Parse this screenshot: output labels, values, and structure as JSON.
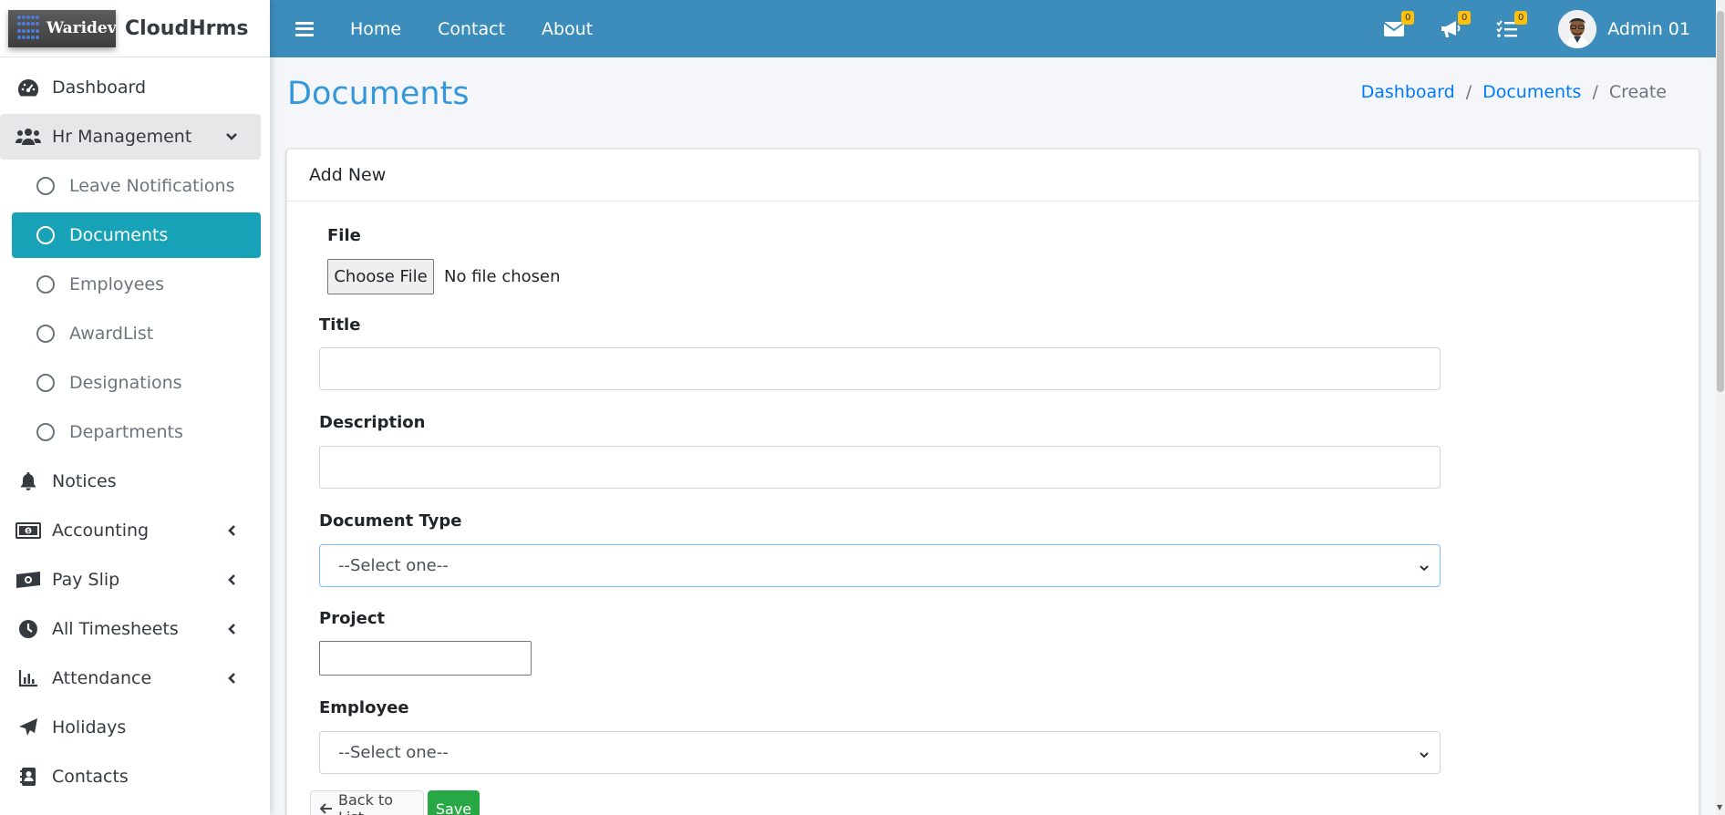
{
  "brand": {
    "logo_text": "Waridev",
    "name": "CloudHrms"
  },
  "topbar": {
    "links": [
      "Home",
      "Contact",
      "About"
    ],
    "badges": {
      "messages": "0",
      "notifications": "0",
      "tasks": "0"
    },
    "user_name": "Admin 01"
  },
  "sidebar": {
    "items": [
      {
        "label": "Dashboard",
        "icon": "dashboard-icon"
      },
      {
        "label": "Hr Management",
        "icon": "users-icon"
      },
      {
        "label": "Notices",
        "icon": "bell-icon"
      },
      {
        "label": "Accounting",
        "icon": "money-icon"
      },
      {
        "label": "Pay Slip",
        "icon": "money-bill-icon"
      },
      {
        "label": "All Timesheets",
        "icon": "clock-icon"
      },
      {
        "label": "Attendance",
        "icon": "chart-icon"
      },
      {
        "label": "Holidays",
        "icon": "paper-plane-icon"
      },
      {
        "label": "Contacts",
        "icon": "address-book-icon"
      }
    ],
    "sub_items": [
      {
        "label": "Leave Notifications"
      },
      {
        "label": "Documents"
      },
      {
        "label": "Employees"
      },
      {
        "label": "AwardList"
      },
      {
        "label": "Designations"
      },
      {
        "label": "Departments"
      }
    ]
  },
  "page": {
    "title": "Documents",
    "breadcrumb": [
      "Dashboard",
      "Documents",
      "Create"
    ]
  },
  "card": {
    "header": "Add New",
    "file_label": "File",
    "file_button": "Choose File",
    "file_status": "No file chosen",
    "title_label": "Title",
    "description_label": "Description",
    "document_type_label": "Document Type",
    "document_type_value": "--Select one--",
    "project_label": "Project",
    "employee_label": "Employee",
    "employee_value": "--Select one--",
    "back_button": "Back to List",
    "save_button": "Save"
  },
  "colors": {
    "topbar": "#3c8dbc",
    "active": "#17a2b8",
    "title": "#3498db",
    "save": "#28a745"
  }
}
